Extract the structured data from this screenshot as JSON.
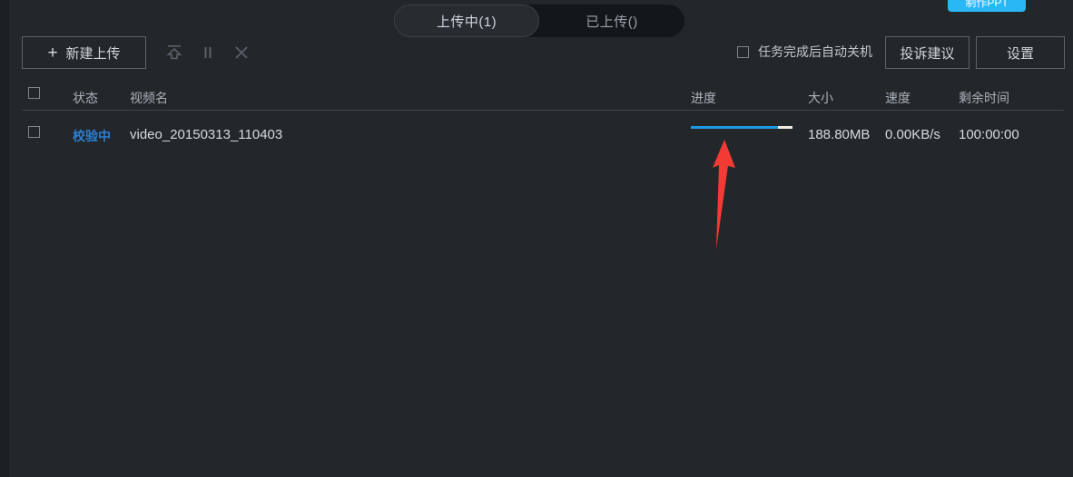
{
  "window": {
    "background_color": "#23272a",
    "accent_color": "#1e9ae0"
  },
  "tabs": [
    {
      "label": "上传中(1)",
      "active": true
    },
    {
      "label": "已上传()",
      "active": false
    }
  ],
  "toolbar": {
    "new_upload_label": "新建上传",
    "new_upload_plus": "+",
    "start_icon": "upload-icon",
    "pause_icon": "pause-icon",
    "close_icon": "close-icon",
    "auto_shutdown_label": "任务完成后自动关机",
    "auto_shutdown_checked": false,
    "feedback_label": "投诉建议",
    "settings_label": "设置"
  },
  "table": {
    "headers": {
      "status": "状态",
      "name": "视频名",
      "progress": "进度",
      "size": "大小",
      "speed": "速度",
      "remaining": "剩余时间"
    },
    "rows": [
      {
        "selected": false,
        "status": "校验中",
        "status_color": "#2b7fd4",
        "name": "video_20150313_110403",
        "progress_percent": 86,
        "size": "188.80MB",
        "speed": "0.00KB/s",
        "remaining": "100:00:00"
      }
    ]
  },
  "annotation": {
    "arrow_color": "#f23b34",
    "points_at": "progress-bar"
  },
  "badge": {
    "text": "制作PPT",
    "color": "#29b7f6"
  }
}
